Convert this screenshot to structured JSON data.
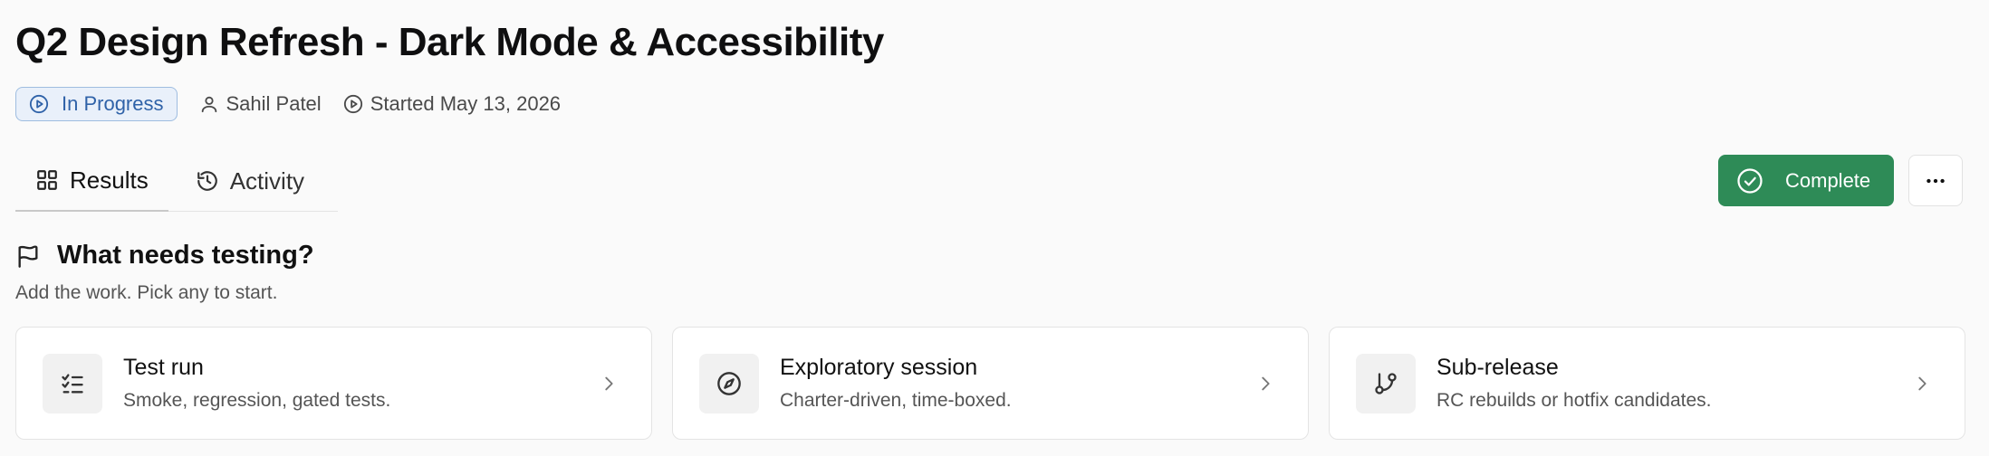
{
  "page": {
    "title": "Q2 Design Refresh - Dark Mode & Accessibility"
  },
  "meta": {
    "status": "In Progress",
    "owner": "Sahil Patel",
    "started": "Started May 13, 2026"
  },
  "tabs": [
    {
      "label": "Results",
      "icon": "grid-icon",
      "active": true
    },
    {
      "label": "Activity",
      "icon": "history-icon",
      "active": false
    }
  ],
  "actions": {
    "complete_label": "Complete",
    "more_icon": "more-horizontal-icon"
  },
  "section": {
    "title": "What needs testing?",
    "subtitle": "Add the work. Pick any to start."
  },
  "cards": [
    {
      "title": "Test run",
      "description": "Smoke, regression, gated tests.",
      "icon": "checklist-icon"
    },
    {
      "title": "Exploratory session",
      "description": "Charter-driven, time-boxed.",
      "icon": "compass-icon"
    },
    {
      "title": "Sub-release",
      "description": "RC rebuilds or hotfix candidates.",
      "icon": "git-branch-icon"
    }
  ],
  "colors": {
    "background": "#fafafa",
    "status_text": "#2f62a8",
    "status_border": "#9fbde0",
    "status_bg": "#e9f0fa",
    "complete_bg": "#2e8b57"
  }
}
